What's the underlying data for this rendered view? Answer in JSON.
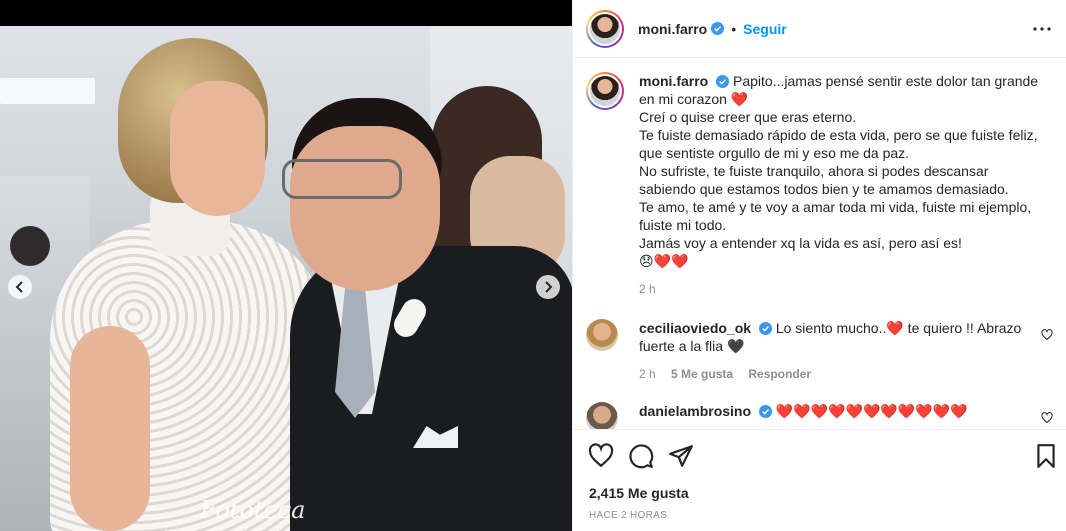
{
  "post": {
    "username": "moni.farro",
    "follow_label": "Seguir",
    "separator": "•",
    "watermark": "Fototeca",
    "caption": {
      "username": "moni.farro",
      "lines": [
        "Papito...jamas pensé sentir este dolor tan grande",
        "en mi corazon ❤️",
        "Creí o quise creer que eras eterno.",
        "Te fuiste demasiado rápido de esta vida, pero se que fuiste feliz,",
        "que sentiste orgullo de mi y eso me da paz.",
        "No sufriste, te fuiste tranquilo, ahora si podes descansar",
        "sabiendo que estamos todos bien y te amamos demasiado.",
        "Te amo, te amé y te voy a amar toda mi vida, fuiste mi ejemplo,",
        "fuiste mi todo.",
        "Jamás voy a entender xq la vida es así, pero así es!",
        "😞❤️❤️"
      ],
      "time": "2 h"
    },
    "comments": [
      {
        "username": "ceciliaoviedo_ok",
        "text_line1": "Lo siento mucho..❤️ te quiero !! Abrazo",
        "text_line2": "fuerte a la flia 🖤",
        "time": "2 h",
        "likes": "5 Me gusta",
        "reply": "Responder"
      },
      {
        "username": "danielambrosino",
        "text_line1": "❤️❤️❤️❤️❤️❤️❤️❤️❤️❤️❤️"
      }
    ],
    "likes_count": "2,415 Me gusta",
    "time_ago": "HACE 2 HORAS"
  },
  "colors": {
    "accent": "#0095f6",
    "verified": "#3897f0",
    "heart": "#d8163c",
    "muted": "#8e8e8e"
  },
  "icons": [
    "chevron-left-icon",
    "chevron-right-icon",
    "more-icon",
    "verified-icon",
    "heart-icon",
    "comment-icon",
    "share-icon",
    "bookmark-icon"
  ]
}
